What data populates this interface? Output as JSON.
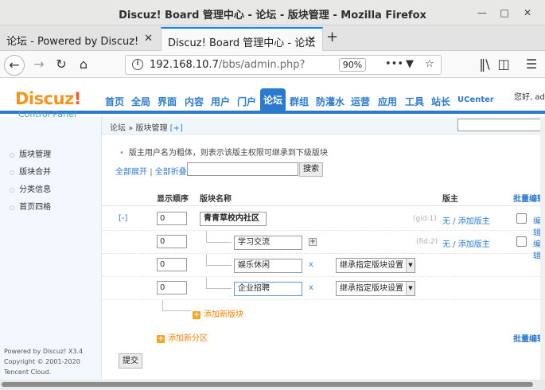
{
  "window": {
    "title": "Discuz! Board 管理中心 - 论坛 - 版块管理 - Mozilla Firefox"
  },
  "tabs": [
    {
      "label": "论坛 - Powered by Discuz!"
    },
    {
      "label": "Discuz! Board 管理中心 - 论坛"
    }
  ],
  "navbar": {
    "url_host": "192.168.10.7",
    "url_path": "/bbs/admin.php?",
    "zoom": "90%"
  },
  "header": {
    "logo_main": "Discuz",
    "logo_bang": "!",
    "logo_sub": "Control Panel",
    "nav": [
      "首页",
      "全局",
      "界面",
      "内容",
      "用户",
      "门户",
      "论坛",
      "群组",
      "防灌水",
      "运营",
      "应用",
      "工具",
      "站长",
      "UCenter"
    ],
    "active": "论坛",
    "user": "您好, ad"
  },
  "breadcrumb": {
    "path": "论坛 » 版块管理",
    "add": "[+]"
  },
  "sidebar": {
    "items": [
      "版块管理",
      "版块合并",
      "分类信息",
      "首页四格"
    ],
    "footer": [
      "Powered by Discuz! X3.4",
      "Copyright © 2001-2020",
      "Tencent Cloud."
    ]
  },
  "main": {
    "tip": "版主用户名为粗体，则表示该版主权限可继承到下级版块",
    "expand_all": "全部展开",
    "sep": "|",
    "collapse_all": "全部折叠",
    "search_btn": "搜索",
    "columns": {
      "order": "显示顺序",
      "name": "版块名称",
      "moderator": "版主",
      "batch": "批量编辑"
    },
    "rows": [
      {
        "toggle": "[-]",
        "order": "0",
        "name": "青青草校内社区",
        "gid": "(gid:1)",
        "mod": "无 / 添加版主",
        "edit": "编辑"
      },
      {
        "order": "0",
        "name": "学习交流",
        "gid": "(fid:2)",
        "mod": "无 / 添加版主",
        "edit": "编辑"
      },
      {
        "order": "0",
        "name": "娱乐休闲",
        "del": "x",
        "inherit": "继承指定版块设置"
      },
      {
        "order": "0",
        "name": "企业招聘",
        "del": "x",
        "inherit": "继承指定版块设置"
      }
    ],
    "add_board": "添加新版块",
    "add_category": "添加新分区",
    "batch_edit": "批量编辑",
    "submit": "提交"
  }
}
